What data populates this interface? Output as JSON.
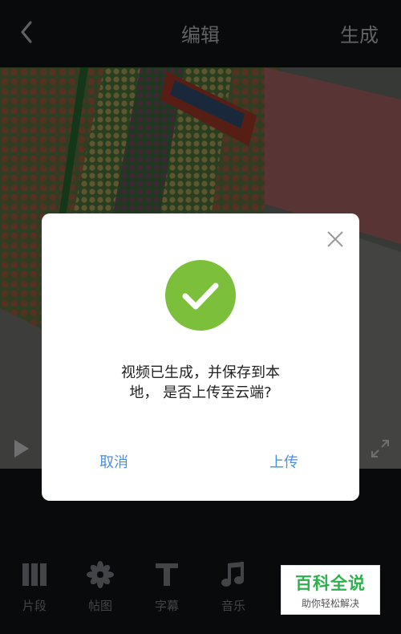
{
  "header": {
    "title": "编辑",
    "generate_label": "生成"
  },
  "dialog": {
    "message_line1": "视频已生成，并保存到本",
    "message_line2": "地， 是否上传至云端?",
    "cancel_label": "取消",
    "upload_label": "上传"
  },
  "toolbar": {
    "items": [
      {
        "label": "片段",
        "icon": "clips-icon"
      },
      {
        "label": "帖图",
        "icon": "sticker-icon"
      },
      {
        "label": "字幕",
        "icon": "subtitle-icon"
      },
      {
        "label": "音乐",
        "icon": "music-icon"
      }
    ]
  },
  "watermark": {
    "title": "百科全说",
    "subtitle": "助你轻松解决"
  },
  "colors": {
    "accent_blue": "#4a90e2",
    "success_green": "#7cbf3a",
    "watermark_green": "#2bb24c"
  }
}
